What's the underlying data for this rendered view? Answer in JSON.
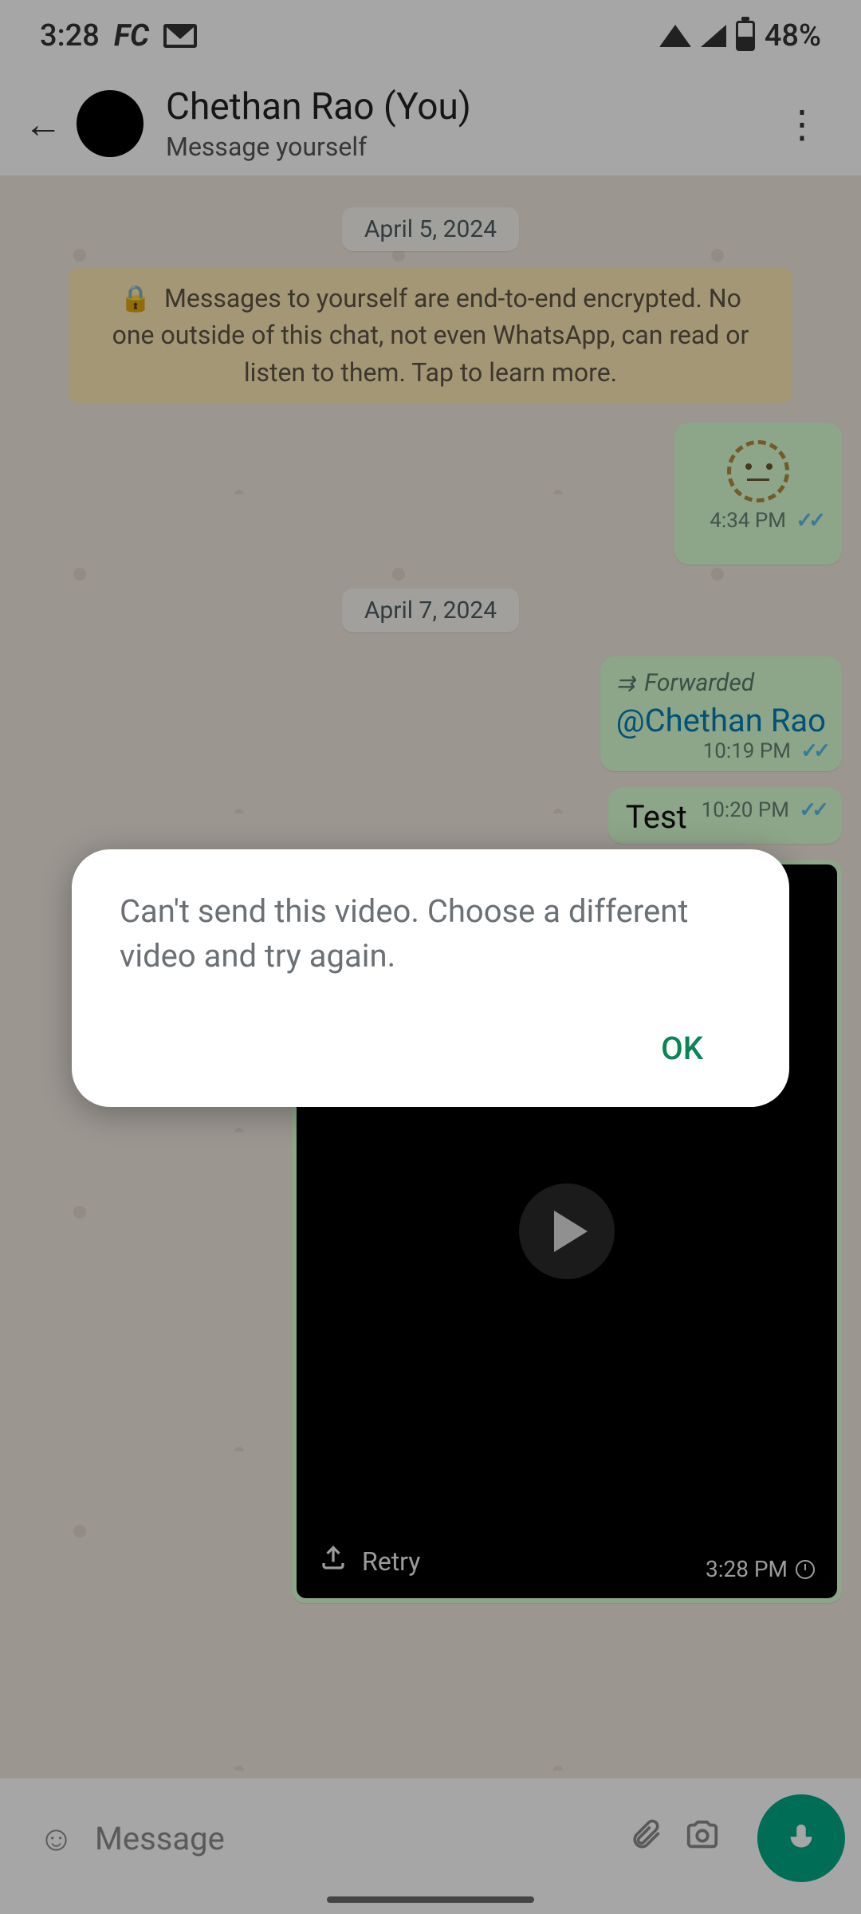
{
  "status": {
    "time": "3:28",
    "indicator": "FC",
    "battery_pct": "48%"
  },
  "header": {
    "contact_name": "Chethan Rao (You)",
    "subtitle": "Message yourself"
  },
  "dates": {
    "d1": "April 5, 2024",
    "d2": "April 7, 2024"
  },
  "encryption_banner": "Messages to yourself are end-to-end encrypted. No one outside of this chat, not even WhatsApp, can read or listen to them. Tap to learn more.",
  "messages": {
    "m1_time": "4:34 PM",
    "m2_forwarded_label": "Forwarded",
    "m2_mention": "@Chethan Rao",
    "m2_time": "10:19 PM",
    "m3_text": "Test",
    "m3_time": "10:20 PM",
    "m4_retry": "Retry",
    "m4_time": "3:28 PM"
  },
  "input": {
    "placeholder": "Message"
  },
  "dialog": {
    "text": "Can't send this video. Choose a different video and try again.",
    "ok": "OK"
  }
}
